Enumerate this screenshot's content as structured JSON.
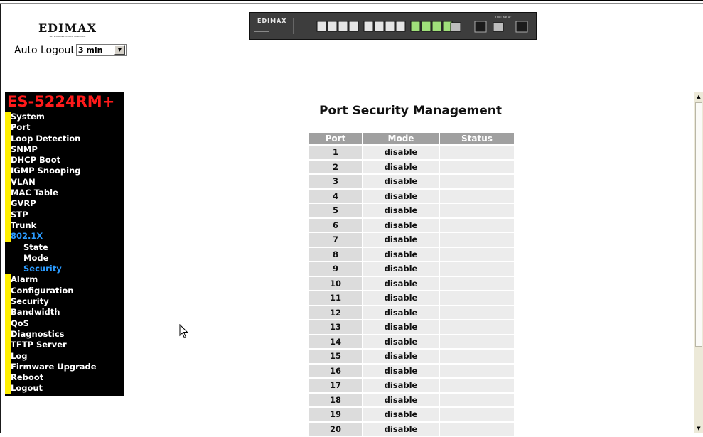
{
  "header": {
    "logo_text": "EDIMAX",
    "logo_tagline": "NETWORKING PEOPLE TOGETHER",
    "auto_logout_label": "Auto Logout",
    "auto_logout_value": "3 min",
    "switch_brand": "EDIMAX"
  },
  "sidebar": {
    "model": "ES-5224RM+",
    "items": [
      {
        "label": "System",
        "active": false,
        "sub": false
      },
      {
        "label": "Port",
        "active": false,
        "sub": false
      },
      {
        "label": "Loop Detection",
        "active": false,
        "sub": false
      },
      {
        "label": "SNMP",
        "active": false,
        "sub": false
      },
      {
        "label": "DHCP Boot",
        "active": false,
        "sub": false
      },
      {
        "label": "IGMP Snooping",
        "active": false,
        "sub": false
      },
      {
        "label": "VLAN",
        "active": false,
        "sub": false
      },
      {
        "label": "MAC Table",
        "active": false,
        "sub": false
      },
      {
        "label": "GVRP",
        "active": false,
        "sub": false
      },
      {
        "label": "STP",
        "active": false,
        "sub": false
      },
      {
        "label": "Trunk",
        "active": false,
        "sub": false
      },
      {
        "label": "802.1X",
        "active": true,
        "sub": false
      },
      {
        "label": "State",
        "active": false,
        "sub": true
      },
      {
        "label": "Mode",
        "active": false,
        "sub": true
      },
      {
        "label": "Security",
        "active": true,
        "sub": true
      },
      {
        "label": "Alarm",
        "active": false,
        "sub": false
      },
      {
        "label": "Configuration",
        "active": false,
        "sub": false
      },
      {
        "label": "Security",
        "active": false,
        "sub": false
      },
      {
        "label": "Bandwidth",
        "active": false,
        "sub": false
      },
      {
        "label": "QoS",
        "active": false,
        "sub": false
      },
      {
        "label": "Diagnostics",
        "active": false,
        "sub": false
      },
      {
        "label": "TFTP Server",
        "active": false,
        "sub": false
      },
      {
        "label": "Log",
        "active": false,
        "sub": false
      },
      {
        "label": "Firmware Upgrade",
        "active": false,
        "sub": false
      },
      {
        "label": "Reboot",
        "active": false,
        "sub": false
      },
      {
        "label": "Logout",
        "active": false,
        "sub": false
      }
    ]
  },
  "main": {
    "title": "Port Security Management",
    "table": {
      "columns": [
        "Port",
        "Mode",
        "Status"
      ],
      "rows": [
        [
          "1",
          "disable",
          ""
        ],
        [
          "2",
          "disable",
          ""
        ],
        [
          "3",
          "disable",
          ""
        ],
        [
          "4",
          "disable",
          ""
        ],
        [
          "5",
          "disable",
          ""
        ],
        [
          "6",
          "disable",
          ""
        ],
        [
          "7",
          "disable",
          ""
        ],
        [
          "8",
          "disable",
          ""
        ],
        [
          "9",
          "disable",
          ""
        ],
        [
          "10",
          "disable",
          ""
        ],
        [
          "11",
          "disable",
          ""
        ],
        [
          "12",
          "disable",
          ""
        ],
        [
          "13",
          "disable",
          ""
        ],
        [
          "14",
          "disable",
          ""
        ],
        [
          "15",
          "disable",
          ""
        ],
        [
          "16",
          "disable",
          ""
        ],
        [
          "17",
          "disable",
          ""
        ],
        [
          "18",
          "disable",
          ""
        ],
        [
          "19",
          "disable",
          ""
        ],
        [
          "20",
          "disable",
          ""
        ]
      ]
    }
  },
  "colors": {
    "sidebar_bg": "#000000",
    "model_red": "#ff1a1a",
    "menu_marker_yellow": "#ffef00",
    "active_blue": "#2b9bff",
    "table_header_bg": "#a0a0a0"
  }
}
